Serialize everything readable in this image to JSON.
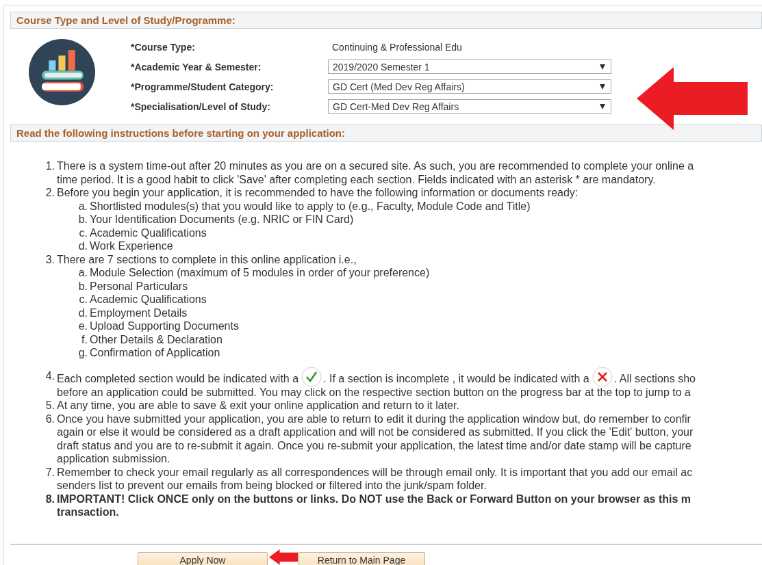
{
  "course_section": {
    "title": "Course Type and Level of Study/Programme:",
    "fields": [
      {
        "label": "*Course Type:",
        "kind": "text",
        "value": "Continuing & Professional Edu"
      },
      {
        "label": "*Academic Year & Semester:",
        "kind": "dropdown",
        "value": "2019/2020 Semester 1"
      },
      {
        "label": "*Programme/Student Category:",
        "kind": "dropdown",
        "value": "GD Cert (Med Dev Reg Affairs)"
      },
      {
        "label": "*Specialisation/Level of Study:",
        "kind": "dropdown",
        "value": "GD Cert-Med Dev Reg Affairs"
      }
    ]
  },
  "instructions": {
    "title": "Read the following instructions before starting on your application:",
    "items": [
      {
        "number": "1.",
        "bold": false,
        "lines": [
          "There is a system time-out after 20 minutes as you are on a secured site. As such, you are recommended to complete your online a",
          "time period. It is a good habit to click 'Save' after completing each section. Fields indicated with an asterisk * are mandatory."
        ]
      },
      {
        "number": "2.",
        "bold": false,
        "lines": [
          "Before you begin your application, it is recommended to have the following information or documents ready:"
        ],
        "children": [
          {
            "letter": "a.",
            "text": "Shortlisted modules(s) that you would like to apply to (e.g., Faculty, Module Code and Title)"
          },
          {
            "letter": "b.",
            "text": "Your Identification Documents (e.g. NRIC or FIN Card)"
          },
          {
            "letter": "c.",
            "text": "Academic Qualifications"
          },
          {
            "letter": "d.",
            "text": "Work Experience"
          }
        ]
      },
      {
        "number": "3.",
        "bold": false,
        "lines": [
          "There are 7 sections to complete in this online application i.e.,"
        ],
        "children": [
          {
            "letter": "a.",
            "text": "Module Selection (maximum of 5 modules in order of your preference)"
          },
          {
            "letter": "b.",
            "text": "Personal Particulars"
          },
          {
            "letter": "c.",
            "text": "Academic Qualifications"
          },
          {
            "letter": "d.",
            "text": "Employment Details"
          },
          {
            "letter": "e.",
            "text": "Upload Supporting Documents"
          },
          {
            "letter": "f.",
            "text": "Other Details & Declaration"
          },
          {
            "letter": "g.",
            "text": "Confirmation of Application"
          }
        ]
      },
      {
        "number": "4.",
        "bold": false,
        "parts": [
          {
            "kind": "text",
            "text": "Each completed section would be indicated with a"
          },
          {
            "kind": "tick"
          },
          {
            "kind": "text",
            "text": ". If a section is incomplete , it would be indicated with a"
          },
          {
            "kind": "cross"
          },
          {
            "kind": "text",
            "text": ". All sections sho"
          }
        ],
        "lines": [
          "before an application could be submitted. You may click on the respective section button on the progress bar at the top to jump to a"
        ]
      },
      {
        "number": "5.",
        "bold": false,
        "lines": [
          "At any time, you are able to save & exit your online application and return to it later."
        ]
      },
      {
        "number": "6.",
        "bold": false,
        "lines": [
          "Once you have submitted your application, you are able to return to edit it during the application window but, do remember to confir",
          "again or else it would be considered as a draft application and will not be considered as submitted. If you click the 'Edit' button, your",
          "draft status and you are to re-submit it again. Once you re-submit your application, the latest time and/or date stamp will be capture",
          "application submission."
        ]
      },
      {
        "number": "7.",
        "bold": false,
        "lines": [
          "Remember to check your email regularly as all correspondences will be through email only. It is important that you add our email ac",
          "senders list to prevent our emails from being blocked or filtered into the junk/spam folder."
        ]
      },
      {
        "number": "8.",
        "bold": true,
        "lines": [
          "IMPORTANT! Click ONCE only on the buttons or links. Do NOT use the Back or Forward Button on your browser as this m",
          "transaction."
        ]
      }
    ]
  },
  "buttons": [
    {
      "label": "Apply Now"
    },
    {
      "label": "Return to Main Page"
    }
  ]
}
